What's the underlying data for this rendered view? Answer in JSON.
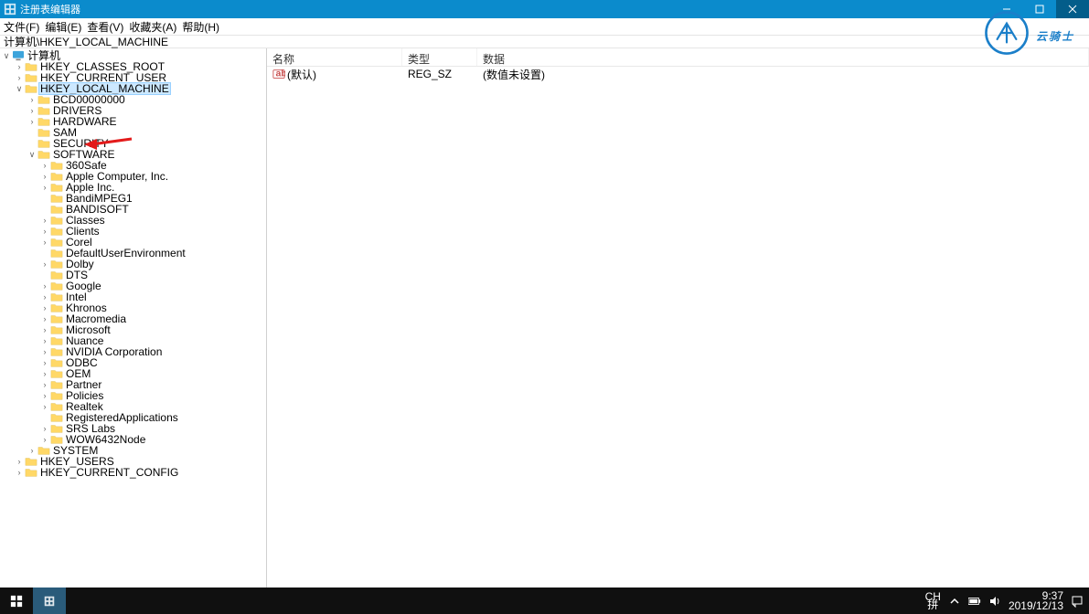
{
  "title": "注册表编辑器",
  "menu": {
    "file": "文件(F)",
    "edit": "编辑(E)",
    "view": "查看(V)",
    "fav": "收藏夹(A)",
    "help": "帮助(H)"
  },
  "path": "计算机\\HKEY_LOCAL_MACHINE",
  "tree_root": "计算机",
  "tree": {
    "hkcr": "HKEY_CLASSES_ROOT",
    "hkcu": "HKEY_CURRENT_USER",
    "hklm": "HKEY_LOCAL_MACHINE",
    "hku": "HKEY_USERS",
    "hkcc": "HKEY_CURRENT_CONFIG",
    "children": [
      "BCD00000000",
      "DRIVERS",
      "HARDWARE",
      "SAM",
      "SECURITY",
      "SOFTWARE",
      "SYSTEM"
    ],
    "software_children": [
      "360Safe",
      "Apple Computer, Inc.",
      "Apple Inc.",
      "BandiMPEG1",
      "BANDISOFT",
      "Classes",
      "Clients",
      "Corel",
      "DefaultUserEnvironment",
      "Dolby",
      "DTS",
      "Google",
      "Intel",
      "Khronos",
      "Macromedia",
      "Microsoft",
      "Nuance",
      "NVIDIA Corporation",
      "ODBC",
      "OEM",
      "Partner",
      "Policies",
      "Realtek",
      "RegisteredApplications",
      "SRS Labs",
      "WOW6432Node"
    ]
  },
  "value_cols": {
    "name": "名称",
    "type": "类型",
    "data": "数据"
  },
  "value_row": {
    "name": "(默认)",
    "type": "REG_SZ",
    "data": "(数值未设置)"
  },
  "watermark": "云骑士",
  "tray": {
    "lang1": "CH",
    "lang2": "拼",
    "time": "9:37",
    "date": "2019/12/13"
  }
}
